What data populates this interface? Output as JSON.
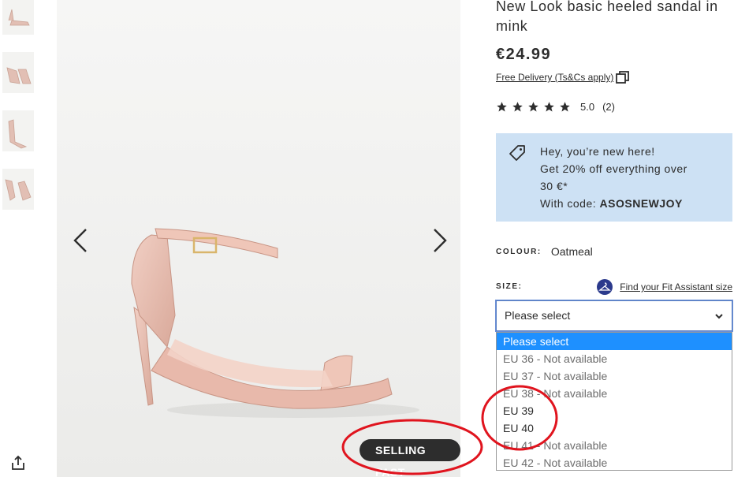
{
  "product": {
    "title": "New Look basic heeled sandal in mink",
    "price": "€24.99",
    "delivery_link": "Free Delivery (Ts&Cs apply)",
    "rating_score": "5.0",
    "rating_count": "(2)",
    "stars": 5
  },
  "promo": {
    "line1": "Hey, you’re new here!",
    "line2": "Get 20% off everything over",
    "line3": "30 €*",
    "code_prefix": "With code: ",
    "code": "ASOSNEWJOY"
  },
  "colour": {
    "label": "COLOUR:",
    "value": "Oatmeal"
  },
  "size": {
    "label": "SIZE:",
    "fit_link": "Find your Fit Assistant size",
    "selected": "Please select",
    "options": [
      "Please select",
      "EU 36 - Not available",
      "EU 37 - Not available",
      "EU 38 - Not available",
      "EU 39",
      "EU 40",
      "EU 41 - Not available",
      "EU 42 - Not available"
    ]
  },
  "badge": "SELLING FAST",
  "colors": {
    "promo_bg": "#cde1f4",
    "highlight": "#1e90ff",
    "annotation": "#e0141e",
    "text": "#2d2d2d"
  }
}
